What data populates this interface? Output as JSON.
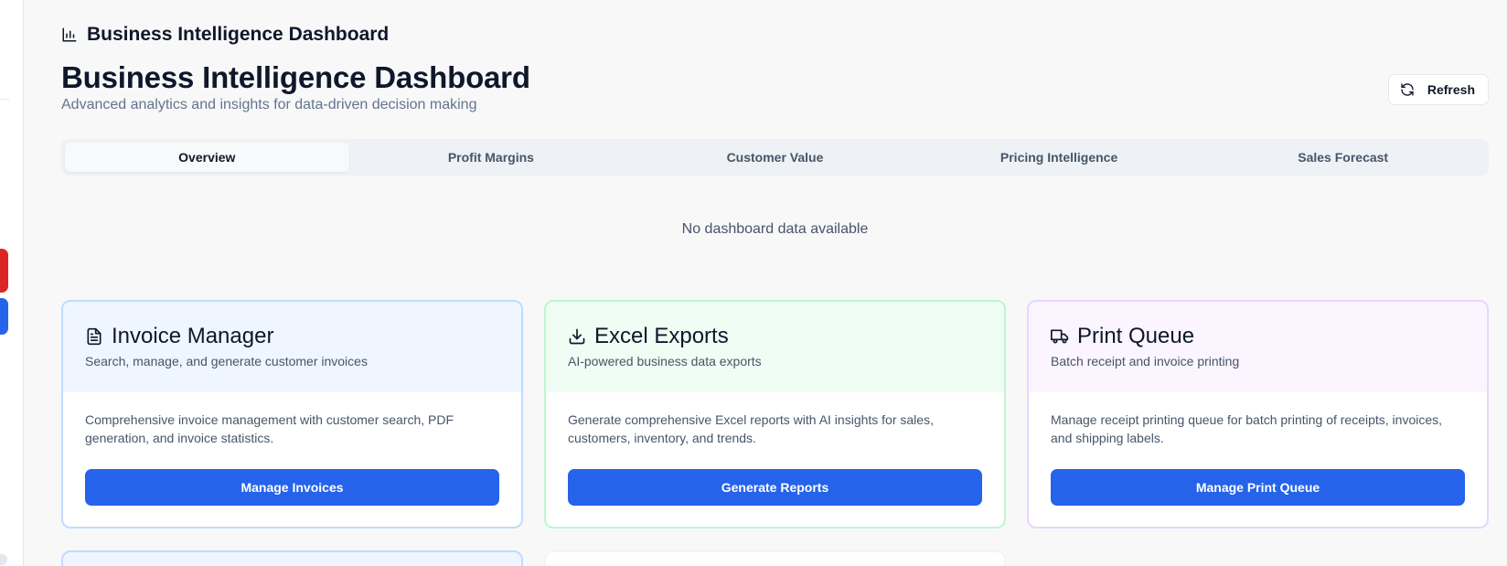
{
  "colors": {
    "accent": "#2563eb",
    "rail_red": "#dc2626",
    "card_blue_border": "#bfdbfe",
    "card_green_border": "#bbf7d0",
    "card_purple_border": "#e9d5ff"
  },
  "header": {
    "breadcrumb_icon": "bar-chart-icon",
    "breadcrumb_label": "Business Intelligence Dashboard",
    "title": "Business Intelligence Dashboard",
    "subtitle": "Advanced analytics and insights for data-driven decision making",
    "refresh": {
      "icon": "refresh-icon",
      "label": "Refresh"
    }
  },
  "tabs": [
    {
      "label": "Overview",
      "active": true
    },
    {
      "label": "Profit Margins",
      "active": false
    },
    {
      "label": "Customer Value",
      "active": false
    },
    {
      "label": "Pricing Intelligence",
      "active": false
    },
    {
      "label": "Sales Forecast",
      "active": false
    }
  ],
  "empty_state": "No dashboard data available",
  "cards": [
    {
      "icon": "document-icon",
      "title": "Invoice Manager",
      "subtitle": "Search, manage, and generate customer invoices",
      "description": "Comprehensive invoice management with customer search, PDF generation, and invoice statistics.",
      "button": "Manage Invoices"
    },
    {
      "icon": "download-icon",
      "title": "Excel Exports",
      "subtitle": "AI-powered business data exports",
      "description": "Generate comprehensive Excel reports with AI insights for sales, customers, inventory, and trends.",
      "button": "Generate Reports"
    },
    {
      "icon": "truck-icon",
      "title": "Print Queue",
      "subtitle": "Batch receipt and invoice printing",
      "description": "Manage receipt printing queue for batch printing of receipts, invoices, and shipping labels.",
      "button": "Manage Print Queue"
    }
  ]
}
